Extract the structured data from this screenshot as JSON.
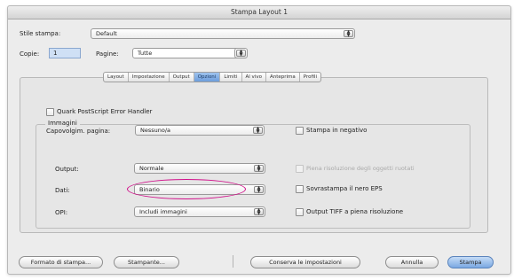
{
  "window": {
    "title": "Stampa Layout 1"
  },
  "style_row": {
    "label": "Stile stampa:",
    "value": "Default"
  },
  "copies_row": {
    "copies_label": "Copie:",
    "copies_value": "1",
    "pages_label": "Pagine:",
    "pages_value": "Tutte"
  },
  "tabs": [
    {
      "label": "Layout"
    },
    {
      "label": "Impostazione"
    },
    {
      "label": "Output"
    },
    {
      "label": "Opzioni",
      "active": true
    },
    {
      "label": "Limiti"
    },
    {
      "label": "Al vivo"
    },
    {
      "label": "Anteprima"
    },
    {
      "label": "Profili"
    }
  ],
  "options": {
    "quark_ps_error_handler": "Quark PostScript Error Handler",
    "page_flip_label": "Capovolgim. pagina:",
    "page_flip_value": "Nessuno/a",
    "negative_print": "Stampa in negativo"
  },
  "images": {
    "group_title": "Immagini",
    "output_label": "Output:",
    "output_value": "Normale",
    "data_label": "Dati:",
    "data_value": "Binario",
    "opi_label": "OPI:",
    "opi_value": "Includi immagini",
    "full_res_disabled": "Piena risoluzione degli oggetti ruotati",
    "overprint_black": "Sovrastampa il nero EPS",
    "tiff_output": "Output TIFF a piena risoluzione"
  },
  "buttons": {
    "page_format": "Formato di stampa...",
    "printer": "Stampante...",
    "save_settings": "Conserva le impostazioni",
    "cancel": "Annulla",
    "print": "Stampa"
  },
  "colors": {
    "highlight_ellipse": "#d10f8a",
    "active_tab": "#7aa8e2"
  }
}
